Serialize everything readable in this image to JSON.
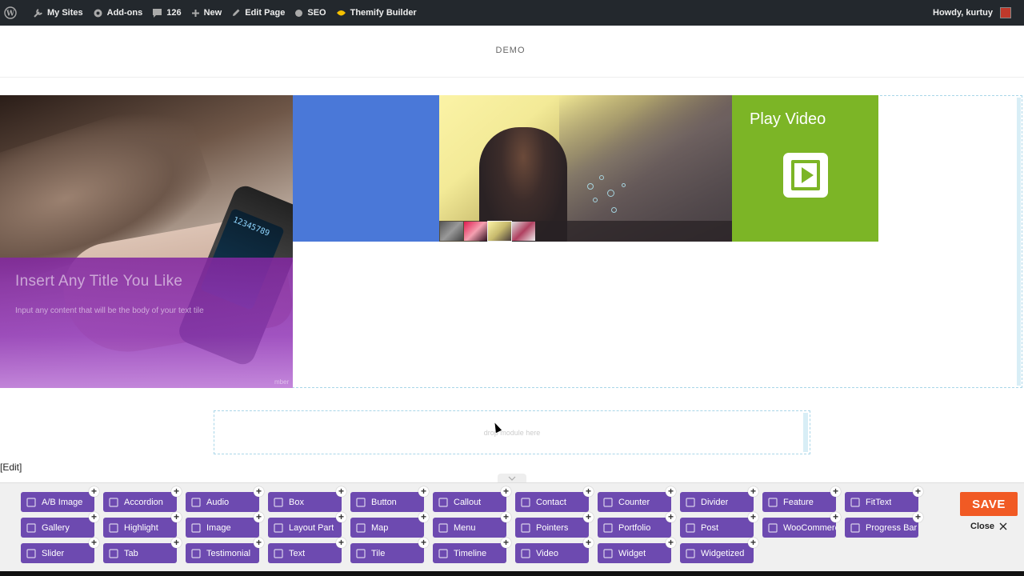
{
  "adminbar": {
    "items": [
      {
        "label": "",
        "icon": "wordpress-icon"
      },
      {
        "label": "My Sites",
        "icon": "sites-icon"
      },
      {
        "label": "Add-ons",
        "icon": "addons-icon"
      },
      {
        "label": "126",
        "icon": "comments-icon"
      },
      {
        "label": "New",
        "icon": "plus-icon"
      },
      {
        "label": "Edit Page",
        "icon": "pencil-icon"
      },
      {
        "label": "SEO",
        "icon": "seo-dot-icon"
      },
      {
        "label": "Themify Builder",
        "icon": "themify-icon"
      }
    ],
    "howdy": "Howdy, kurtuy"
  },
  "site": {
    "title": "DEMO"
  },
  "tiles": {
    "text_tile": {
      "title": "Insert Any Title You Like",
      "body": "Input any content that will be the body of your text tile",
      "footer": "mber",
      "watch_digits": "12345789"
    },
    "video_tile": {
      "label": "Play Video"
    }
  },
  "dropzone": {
    "text": "drop module here"
  },
  "edit_link": "[Edit]",
  "panel": {
    "save_label": "SAVE",
    "close_label": "Close",
    "modules": [
      {
        "label": "A/B Image",
        "icon": "ab-image-icon"
      },
      {
        "label": "Accordion",
        "icon": "accordion-icon"
      },
      {
        "label": "Audio",
        "icon": "audio-icon"
      },
      {
        "label": "Box",
        "icon": "box-icon"
      },
      {
        "label": "Button",
        "icon": "button-icon"
      },
      {
        "label": "Callout",
        "icon": "callout-icon"
      },
      {
        "label": "Contact",
        "icon": "contact-icon"
      },
      {
        "label": "Counter",
        "icon": "counter-icon"
      },
      {
        "label": "Divider",
        "icon": "divider-icon"
      },
      {
        "label": "Feature",
        "icon": "feature-icon"
      },
      {
        "label": "FitText",
        "icon": "fittext-icon"
      },
      {
        "label": "Gallery",
        "icon": "gallery-icon"
      },
      {
        "label": "Highlight",
        "icon": "highlight-icon"
      },
      {
        "label": "Image",
        "icon": "image-icon"
      },
      {
        "label": "Layout Part",
        "icon": "layout-part-icon"
      },
      {
        "label": "Map",
        "icon": "map-icon"
      },
      {
        "label": "Menu",
        "icon": "menu-icon"
      },
      {
        "label": "Pointers",
        "icon": "pointers-icon"
      },
      {
        "label": "Portfolio",
        "icon": "portfolio-icon"
      },
      {
        "label": "Post",
        "icon": "post-icon"
      },
      {
        "label": "WooCommerce",
        "icon": "cart-icon"
      },
      {
        "label": "Progress Bar",
        "icon": "progress-bar-icon"
      },
      {
        "label": "Slider",
        "icon": "slider-icon"
      },
      {
        "label": "Tab",
        "icon": "tab-icon"
      },
      {
        "label": "Testimonial",
        "icon": "testimonial-icon"
      },
      {
        "label": "Text",
        "icon": "text-icon"
      },
      {
        "label": "Tile",
        "icon": "tile-icon"
      },
      {
        "label": "Timeline",
        "icon": "timeline-icon"
      },
      {
        "label": "Video",
        "icon": "video-icon"
      },
      {
        "label": "Widget",
        "icon": "widget-icon"
      },
      {
        "label": "Widgetized",
        "icon": "widgetized-icon"
      }
    ]
  },
  "colors": {
    "adminbar": "#23282d",
    "module": "#6d4ab0",
    "save": "#f15a24",
    "tile_blue": "#4a78d8",
    "tile_green": "#7cb526"
  }
}
